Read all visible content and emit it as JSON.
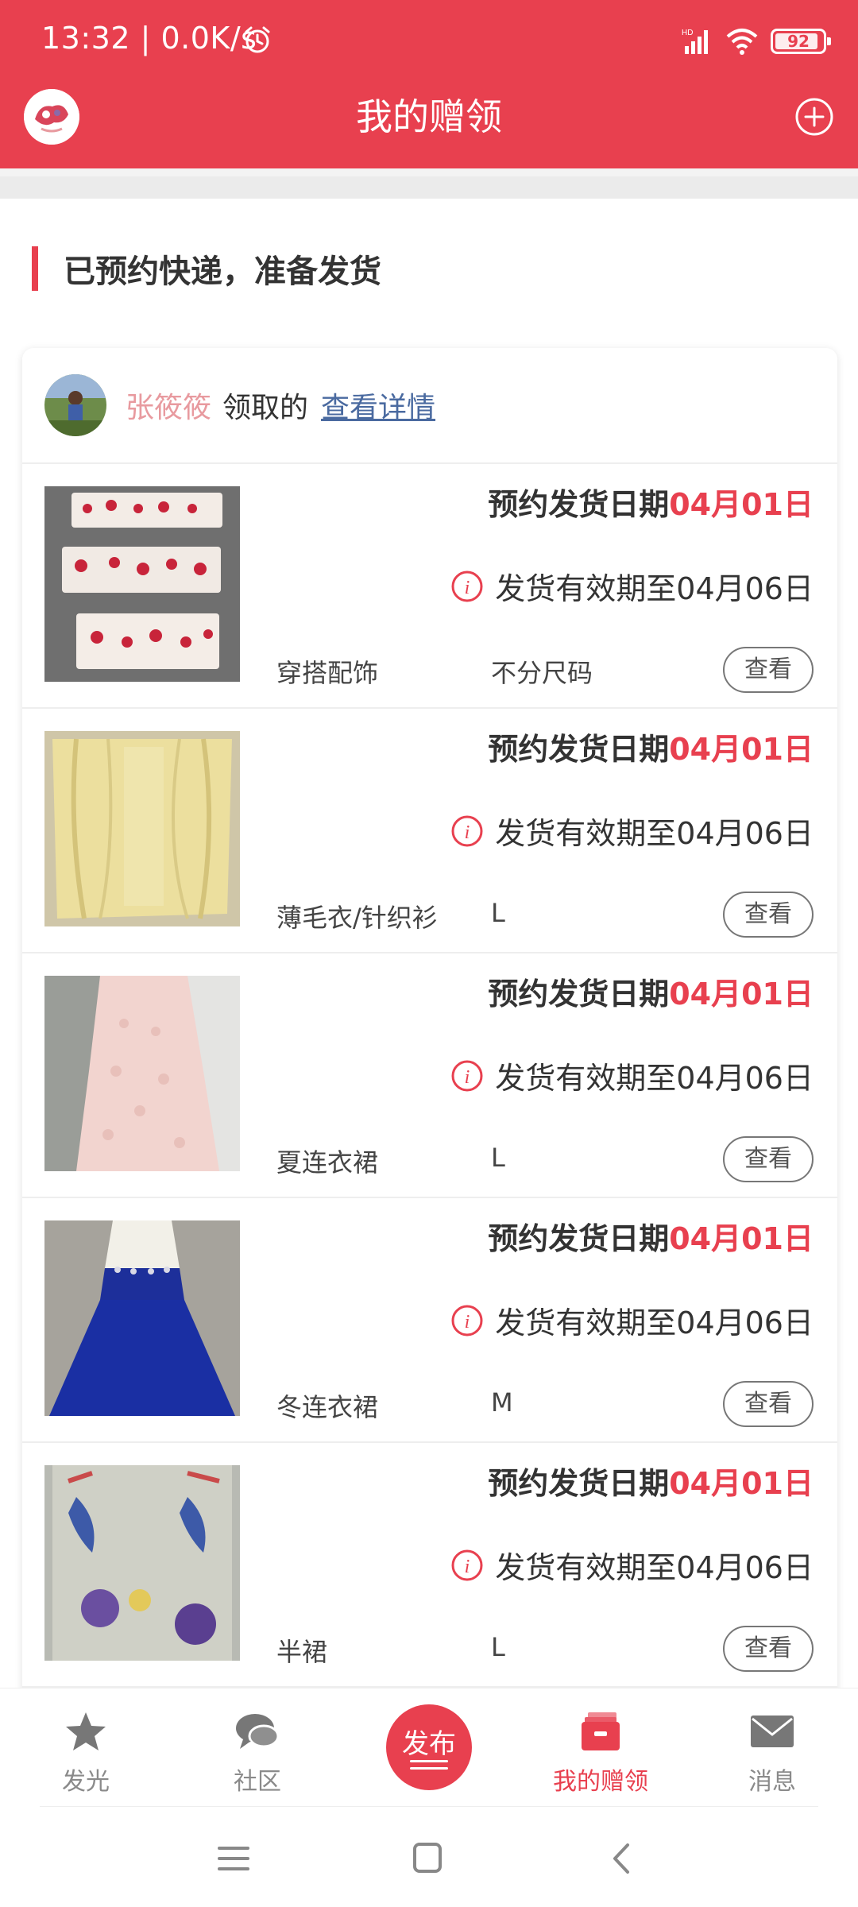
{
  "status_bar": {
    "time": "13:32 | 0.0K/s",
    "battery": "92"
  },
  "header": {
    "title": "我的赠领"
  },
  "section": {
    "title": "已预约快递，准备发货"
  },
  "card": {
    "claimer": "张筱筱",
    "claimed_text": "领取的",
    "details_link": "查看详情"
  },
  "items": [
    {
      "date_label": "预约发货日期",
      "date": "04月01日",
      "valid": "发货有效期至04月06日",
      "category": "穿搭配饰",
      "size": "不分尺码",
      "view": "查看"
    },
    {
      "date_label": "预约发货日期",
      "date": "04月01日",
      "valid": "发货有效期至04月06日",
      "category": "薄毛衣/针织衫",
      "size": "L",
      "view": "查看"
    },
    {
      "date_label": "预约发货日期",
      "date": "04月01日",
      "valid": "发货有效期至04月06日",
      "category": "夏连衣裙",
      "size": "L",
      "view": "查看"
    },
    {
      "date_label": "预约发货日期",
      "date": "04月01日",
      "valid": "发货有效期至04月06日",
      "category": "冬连衣裙",
      "size": "M",
      "view": "查看"
    },
    {
      "date_label": "预约发货日期",
      "date": "04月01日",
      "valid": "发货有效期至04月06日",
      "category": "半裙",
      "size": "L",
      "view": "查看"
    }
  ],
  "tabbar": {
    "tabs": [
      {
        "label": "发光",
        "icon": "star-icon"
      },
      {
        "label": "社区",
        "icon": "chat-icon"
      },
      {
        "label": "发布",
        "icon": "publish-icon"
      },
      {
        "label": "我的赠领",
        "icon": "gift-box-icon"
      },
      {
        "label": "消息",
        "icon": "mail-icon"
      }
    ],
    "active_index": 3
  },
  "colors": {
    "accent": "#e8404f",
    "link": "#4a6aa0"
  }
}
